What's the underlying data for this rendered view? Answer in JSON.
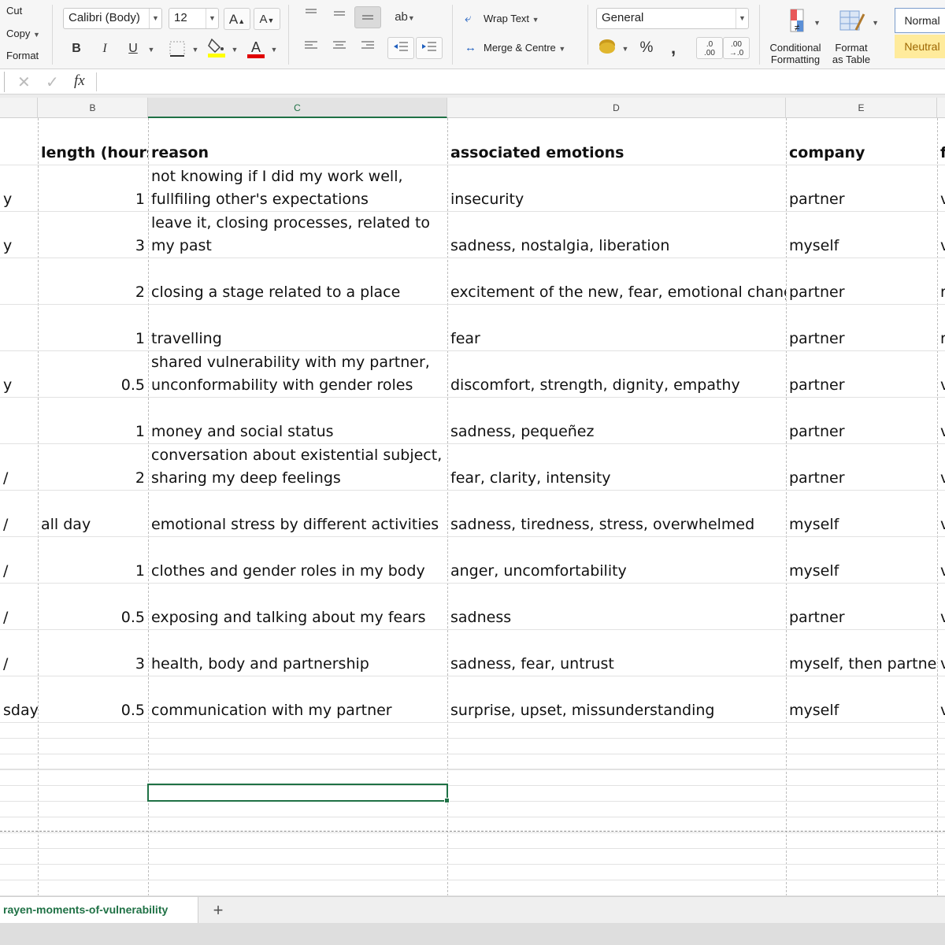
{
  "ribbon": {
    "clipboard": {
      "cut": "Cut",
      "copy": "Copy",
      "format": "Format"
    },
    "font": {
      "name": "Calibri (Body)",
      "size": "12",
      "grow": "A",
      "shrink": "A",
      "bold": "B",
      "italic": "I",
      "underline": "U",
      "font_color_letter": "A",
      "fill_color": "#ffff00",
      "font_color": "#e00000"
    },
    "wrap_text": "Wrap Text",
    "merge_centre": "Merge & Centre",
    "number_format": "General",
    "percent": "%",
    "comma": ",",
    "dec_increase_top": ".0",
    "dec_increase_bottom": ".00",
    "dec_decrease_top": ".00",
    "dec_decrease_bottom": "→.0",
    "conditional_formatting": [
      "Conditional",
      "Formatting"
    ],
    "format_as_table": [
      "Format",
      "as Table"
    ],
    "styles": {
      "normal": "Normal",
      "neutral": "Neutral",
      "neutral_bg": "#ffeb9c",
      "neutral_color": "#9c6500"
    }
  },
  "formula_bar": {
    "cancel": "✕",
    "enter": "✓",
    "fx": "fx",
    "value": ""
  },
  "columns": {
    "b": "B",
    "c": "C",
    "d": "D",
    "e": "E"
  },
  "sheet": {
    "header": {
      "a": "",
      "b": "length (hours)",
      "c": "reason",
      "d": "associated emotions",
      "e": "company"
    },
    "rows": [
      {
        "a": "y",
        "b": "1",
        "c": "not knowing if I did my work well, fullfiling other's expectations",
        "d": "insecurity",
        "e": "partner",
        "f": "v"
      },
      {
        "a": "y",
        "b": "3",
        "c": "organizing things of my last home to leave it, closing processes, related to my past",
        "d": "sadness, nostalgia, liberation",
        "e": "myself",
        "f": "v"
      },
      {
        "a": "",
        "b": "2",
        "c": "closing a stage related to a place",
        "d": "excitement of the new, fear, emotional change",
        "e": "partner",
        "f": "r"
      },
      {
        "a": "",
        "b": "1",
        "c": "travelling",
        "d": "fear",
        "e": "partner",
        "f": "r"
      },
      {
        "a": "y",
        "b": "0.5",
        "c": "shared vulnerability with my partner, unconformability with gender roles",
        "d": "discomfort, strength, dignity, empathy",
        "e": "partner",
        "f": "v"
      },
      {
        "a": "",
        "b": "1",
        "c": "money and social status",
        "d": "sadness, pequeñez",
        "e": "partner",
        "f": "v"
      },
      {
        "a": "/",
        "b": "2",
        "c": "conversation about existential subject, sharing my deep feelings",
        "d": "fear, clarity, intensity",
        "e": "partner",
        "f": "v"
      },
      {
        "a": "/",
        "b": "all day",
        "c": "emotional stress by different activities",
        "d": "sadness, tiredness, stress, overwhelmed",
        "e": "myself",
        "f": "v"
      },
      {
        "a": "/",
        "b": "1",
        "c": "clothes and gender roles in my body",
        "d": "anger, uncomfortability",
        "e": "myself",
        "f": "v"
      },
      {
        "a": "/",
        "b": "0.5",
        "c": "exposing and talking about my fears",
        "d": "sadness",
        "e": "partner",
        "f": "v"
      },
      {
        "a": "/",
        "b": "3",
        "c": "health, body and partnership",
        "d": "sadness, fear, untrust",
        "e": "myself, then partner",
        "f": "v"
      },
      {
        "a": "sday",
        "b": "0.5",
        "c": "communication with my partner",
        "d": "surprise, upset, missunderstanding",
        "e": "myself",
        "f": "v"
      }
    ]
  },
  "tabs": {
    "sheet_name": "rayen-moments-of-vulnerability",
    "add": "+"
  }
}
